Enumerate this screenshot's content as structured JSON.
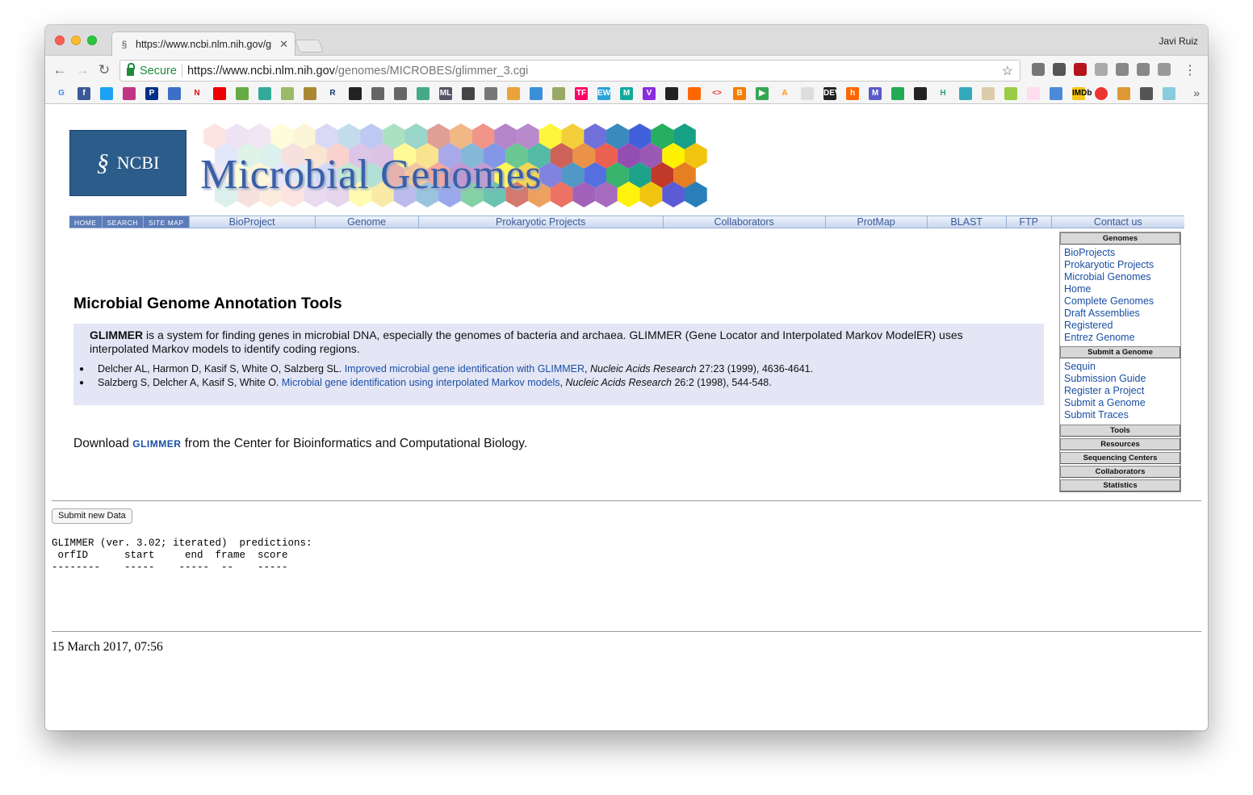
{
  "browser": {
    "tab_title": "https://www.ncbi.nlm.nih.gov/g",
    "profile_name": "Javi Ruiz",
    "secure_label": "Secure",
    "url_main": "https://www.ncbi.nlm.nih.gov",
    "url_rest": "/genomes/MICROBES/glimmer_3.cgi"
  },
  "header": {
    "logo_text": "NCBI",
    "banner_title": "Microbial Genomes",
    "nav_mini": [
      "HOME",
      "SEARCH",
      "SITE MAP"
    ],
    "nav_items": [
      "BioProject",
      "Genome",
      "Prokaryotic Projects",
      "Collaborators",
      "ProtMap",
      "BLAST",
      "FTP",
      "Contact us"
    ]
  },
  "sidebar": {
    "sections": [
      {
        "title": "Genomes",
        "links": [
          "BioProjects",
          "Prokaryotic Projects",
          "Microbial Genomes",
          "Home",
          "Complete Genomes",
          "Draft Assemblies",
          "Registered",
          "Entrez Genome"
        ]
      },
      {
        "title": "Submit a Genome",
        "links": [
          "Sequin",
          "Submission Guide",
          "Register a Project",
          "Submit a Genome",
          "Submit Traces"
        ]
      },
      {
        "title": "Tools",
        "links": []
      },
      {
        "title": "Resources",
        "links": []
      },
      {
        "title": "Sequencing Centers",
        "links": []
      },
      {
        "title": "Collaborators",
        "links": []
      },
      {
        "title": "Statistics",
        "links": []
      }
    ]
  },
  "main": {
    "title": "Microbial Genome Annotation Tools",
    "desc_bold": "GLIMMER",
    "desc_text": " is a system for finding genes in microbial DNA, especially the genomes of bacteria and archaea. GLIMMER (Gene Locator and Interpolated Markov ModelER) uses interpolated Markov models to identify coding regions.",
    "refs": [
      {
        "authors": "Delcher AL, Harmon D, Kasif S, White O, Salzberg SL. ",
        "link": "Improved microbial gene identification with GLIMMER",
        "journal": "Nucleic Acids Research",
        "detail": " 27:23 (1999), 4636-4641."
      },
      {
        "authors": " Salzberg S, Delcher A, Kasif S, White O. ",
        "link": "Microbial gene identification using interpolated Markov models",
        "journal": "Nucleic Acids Research",
        "detail": " 26:2 (1998), 544-548."
      }
    ],
    "download_prefix": "Download ",
    "download_link": "GLIMMER",
    "download_suffix": " from the Center for Bioinformatics and Computational Biology.",
    "submit_label": "Submit new Data",
    "predictions_header": "GLIMMER (ver. 3.02; iterated)  predictions:",
    "predictions_columns": " orfID      start     end  frame  score",
    "predictions_divider": "--------    -----    -----  --    -----",
    "date": "15 March 2017, 07:56"
  }
}
